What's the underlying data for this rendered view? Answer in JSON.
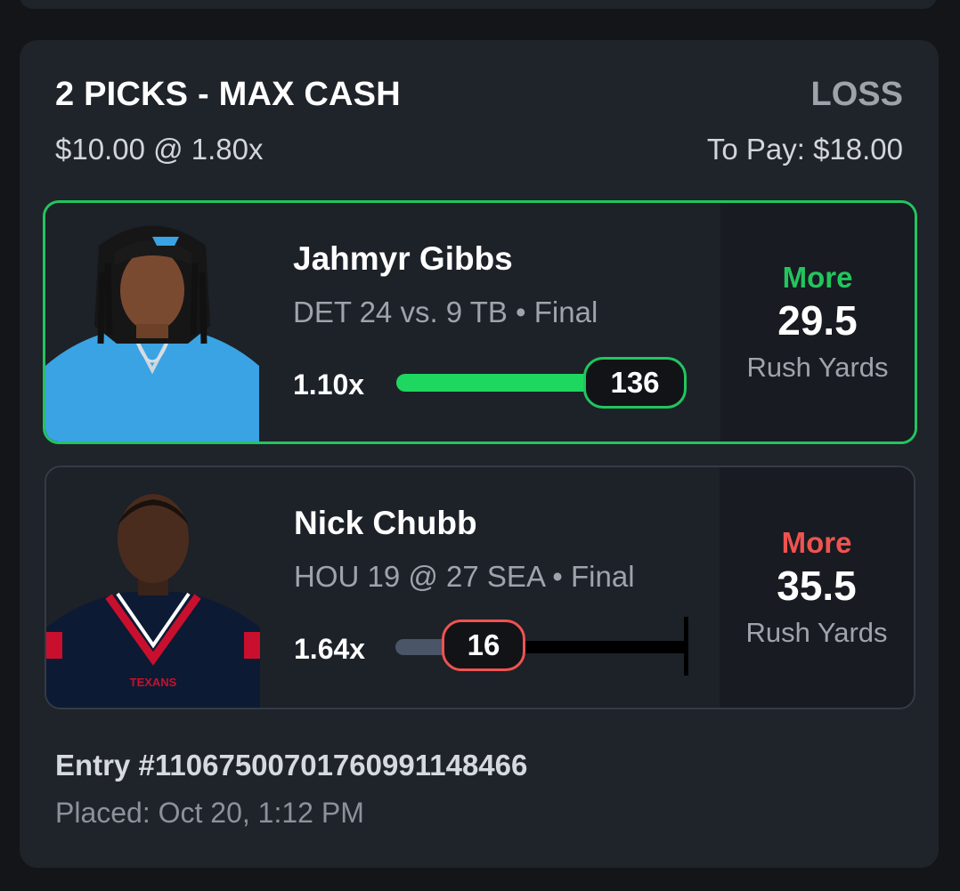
{
  "entry": {
    "title": "2 PICKS - MAX CASH",
    "stake_line": "$10.00 @ 1.80x",
    "result": "LOSS",
    "to_pay": "To Pay: $18.00",
    "entry_id": "Entry #1106750070176099114846​6",
    "placed": "Placed: Oct 20, 1:12 PM"
  },
  "picks": [
    {
      "player": "Jahmyr Gibbs",
      "game": "DET 24 vs. 9 TB • Final",
      "multiplier": "1.10x",
      "actual": "136",
      "direction": "More",
      "line": "29.5",
      "stat": "Rush Yards",
      "status": "won",
      "accent": "#22c55e",
      "jersey_color": "#3aa3e3",
      "icon": "player-headshot"
    },
    {
      "player": "Nick Chubb",
      "game": "HOU 19 @ 27 SEA • Final",
      "multiplier": "1.64x",
      "actual": "16",
      "direction": "More",
      "line": "35.5",
      "stat": "Rush Yards",
      "status": "lost",
      "progress_fraction": 0.45,
      "accent": "#ef5350",
      "jersey_color": "#0d1a33",
      "jersey_text": "TEXANS",
      "icon": "player-headshot"
    }
  ]
}
